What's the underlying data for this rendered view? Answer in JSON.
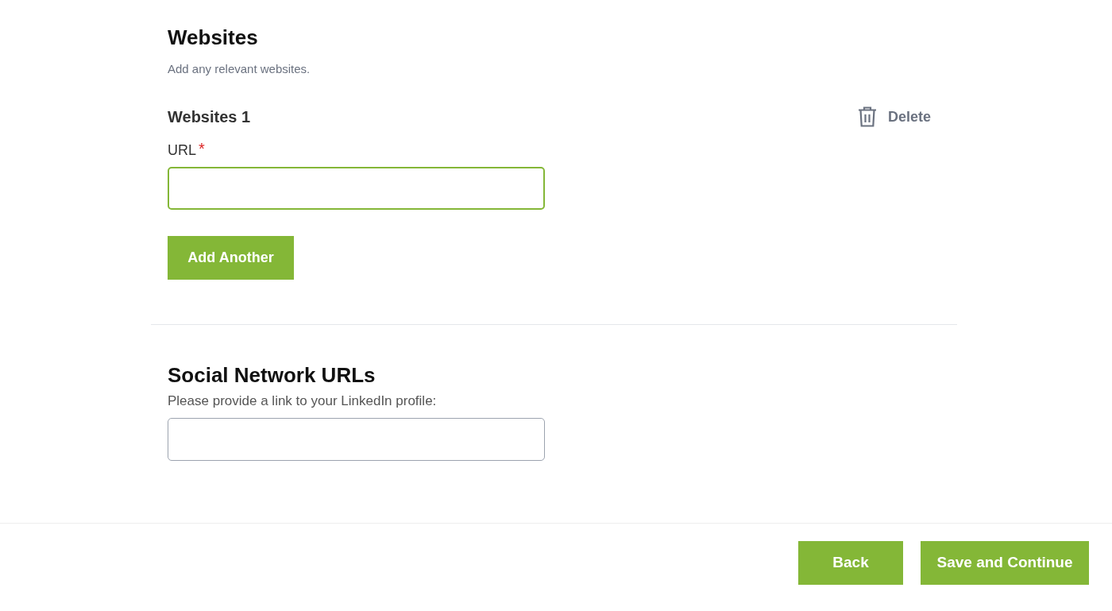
{
  "websites": {
    "title": "Websites",
    "description": "Add any relevant websites.",
    "entries": [
      {
        "title": "Websites 1",
        "delete": "Delete",
        "field": {
          "label": "URL",
          "required_mark": "*",
          "focused": true
        }
      }
    ],
    "add_button": "Add Another"
  },
  "social": {
    "title": "Social Network URLs",
    "field": {
      "label": "Please provide a link to your LinkedIn profile:",
      "focused": false
    }
  },
  "footer": {
    "buttons": [
      "Back",
      "Save and Continue"
    ]
  }
}
